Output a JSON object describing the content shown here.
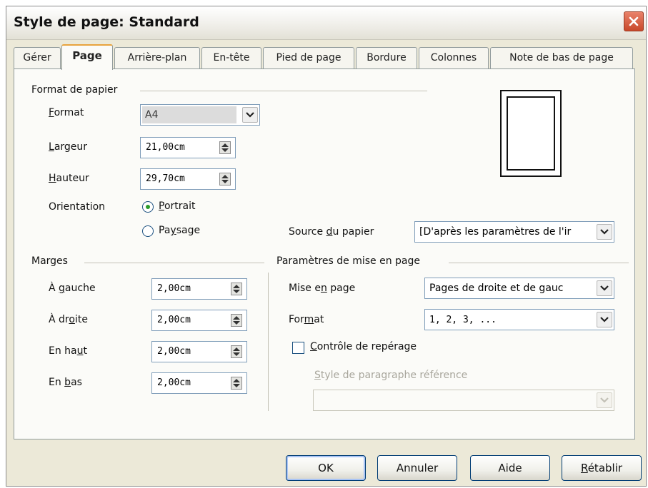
{
  "window": {
    "title": "Style de page: Standard"
  },
  "tabs": [
    {
      "label": "Gérer"
    },
    {
      "label": "Page"
    },
    {
      "label": "Arrière-plan"
    },
    {
      "label": "En-tête"
    },
    {
      "label": "Pied de page"
    },
    {
      "label": "Bordure"
    },
    {
      "label": "Colonnes"
    },
    {
      "label": "Note de bas de page"
    }
  ],
  "paper_format": {
    "section_title": "Format de papier",
    "format_label": "Format",
    "format_value": "A4",
    "width_label": "Largeur",
    "width_value": "21,00cm",
    "height_label": "Hauteur",
    "height_value": "29,70cm",
    "orientation_label": "Orientation",
    "portrait_label": "Portrait",
    "landscape_label": "Paysage",
    "orientation_selected": "Portrait"
  },
  "paper_source": {
    "label": "Source du papier",
    "value": "[D'après les paramètres de l'ir"
  },
  "margins": {
    "section_title": "Marges",
    "left_label": "À gauche",
    "left_value": "2,00cm",
    "right_label": "À droite",
    "right_value": "2,00cm",
    "top_label": "En haut",
    "top_value": "2,00cm",
    "bottom_label": "En bas",
    "bottom_value": "2,00cm"
  },
  "layout": {
    "section_title": "Paramètres de mise en page",
    "layout_label": "Mise en page",
    "layout_value": "Pages de droite et de gauc",
    "format_label": "Format",
    "format_value": "1, 2, 3, ...",
    "register_label": "Contrôle de repérage",
    "register_checked": false,
    "ref_style_label": "Style de paragraphe référence",
    "ref_style_value": ""
  },
  "buttons": {
    "ok": "OK",
    "cancel": "Annuler",
    "help": "Aide",
    "reset": "Rétablir"
  }
}
